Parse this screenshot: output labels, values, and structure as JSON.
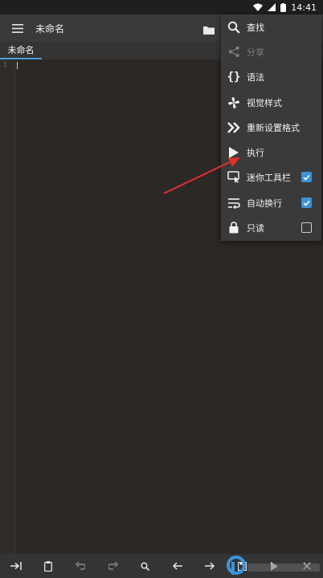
{
  "status_bar": {
    "time": "14:41"
  },
  "app_bar": {
    "title": "未命名"
  },
  "tabs": [
    {
      "label": "未命名"
    }
  ],
  "editor": {
    "line_number": "1"
  },
  "menu": {
    "items": [
      {
        "label": "查找",
        "icon": "search-icon"
      },
      {
        "label": "分享",
        "icon": "share-icon",
        "disabled": true
      },
      {
        "label": "语法",
        "icon": "braces-icon"
      },
      {
        "label": "视觉样式",
        "icon": "fan-icon"
      },
      {
        "label": "重新设置格式",
        "icon": "double-chevron-icon"
      },
      {
        "label": "执行",
        "icon": "play-icon"
      },
      {
        "label": "迷你工具栏",
        "icon": "toolbar-icon",
        "checked": true
      },
      {
        "label": "自动换行",
        "icon": "wrap-icon",
        "checked": true
      },
      {
        "label": "只读",
        "icon": "lock-icon",
        "checked": false
      }
    ]
  },
  "colors": {
    "accent": "#3b93d8",
    "annotation_arrow": "#e0302b"
  }
}
